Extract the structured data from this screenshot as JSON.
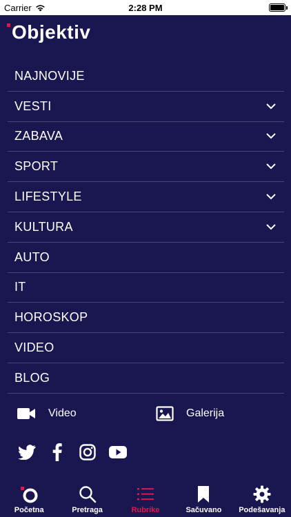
{
  "status_bar": {
    "carrier": "Carrier",
    "time": "2:28 PM"
  },
  "logo": {
    "text": "Objektiv"
  },
  "menu": {
    "items": [
      {
        "label": "NAJNOVIJE",
        "expandable": false
      },
      {
        "label": "VESTI",
        "expandable": true
      },
      {
        "label": "ZABAVA",
        "expandable": true
      },
      {
        "label": "SPORT",
        "expandable": true
      },
      {
        "label": "LIFESTYLE",
        "expandable": true
      },
      {
        "label": "KULTURA",
        "expandable": true
      },
      {
        "label": "AUTO",
        "expandable": false
      },
      {
        "label": "IT",
        "expandable": false
      },
      {
        "label": "HOROSKOP",
        "expandable": false
      },
      {
        "label": "VIDEO",
        "expandable": false
      },
      {
        "label": "BLOG",
        "expandable": false
      }
    ]
  },
  "media": {
    "video_label": "Video",
    "gallery_label": "Galerija"
  },
  "social": [
    "twitter-icon",
    "facebook-icon",
    "instagram-icon",
    "youtube-icon"
  ],
  "tabbar": {
    "tabs": [
      {
        "label": "Početna",
        "icon": "home-logo-icon",
        "active": false
      },
      {
        "label": "Pretraga",
        "icon": "search-icon",
        "active": false
      },
      {
        "label": "Rubrike",
        "icon": "list-icon",
        "active": true
      },
      {
        "label": "Sačuvano",
        "icon": "bookmark-icon",
        "active": false
      },
      {
        "label": "Podešavanja",
        "icon": "gear-icon",
        "active": false
      }
    ]
  },
  "colors": {
    "background": "#1a1650",
    "accent": "#e3174a",
    "divider": "#4a4778",
    "text": "#ffffff"
  }
}
